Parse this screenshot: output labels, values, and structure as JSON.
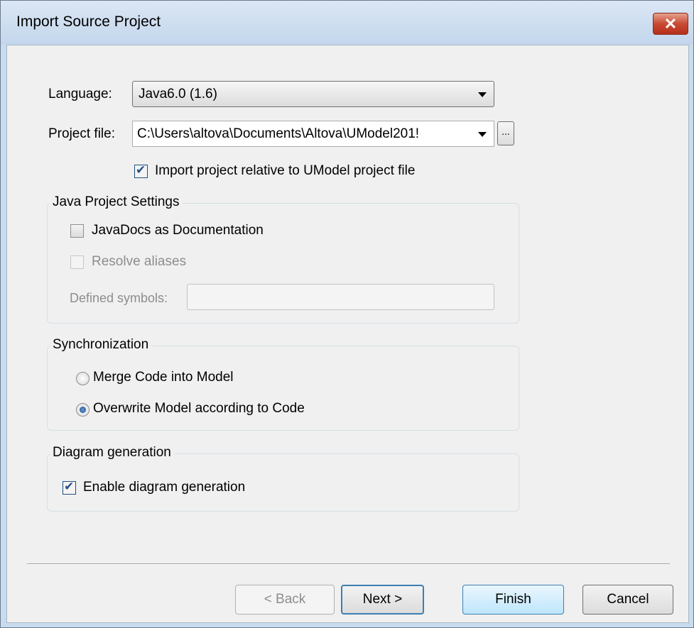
{
  "window": {
    "title": "Import Source Project",
    "close_glyph": "✕"
  },
  "language": {
    "label": "Language:",
    "value": "Java6.0 (1.6)"
  },
  "project_file": {
    "label": "Project file:",
    "value": "C:\\Users\\altova\\Documents\\Altova\\UModel201!",
    "browse_label": "..."
  },
  "import_relative": {
    "label": "Import project relative to UModel project file",
    "checked": true
  },
  "java_settings": {
    "title": "Java Project Settings",
    "javadocs": {
      "label": "JavaDocs as Documentation",
      "checked": false
    },
    "resolve_aliases": {
      "label": "Resolve aliases",
      "checked": false,
      "disabled": true
    },
    "defined_symbols": {
      "label": "Defined symbols:",
      "value": ""
    }
  },
  "synchronization": {
    "title": "Synchronization",
    "options": [
      {
        "label": "Merge Code into Model",
        "selected": false
      },
      {
        "label": "Overwrite Model according to Code",
        "selected": true
      }
    ]
  },
  "diagram_generation": {
    "title": "Diagram generation",
    "enable": {
      "label": "Enable diagram generation",
      "checked": true
    }
  },
  "buttons": {
    "back": "< Back",
    "next": "Next >",
    "finish": "Finish",
    "cancel": "Cancel"
  },
  "colors": {
    "accent": "#3c7fb1",
    "close_red": "#c94a33",
    "title_bar": "#c9dcef"
  }
}
